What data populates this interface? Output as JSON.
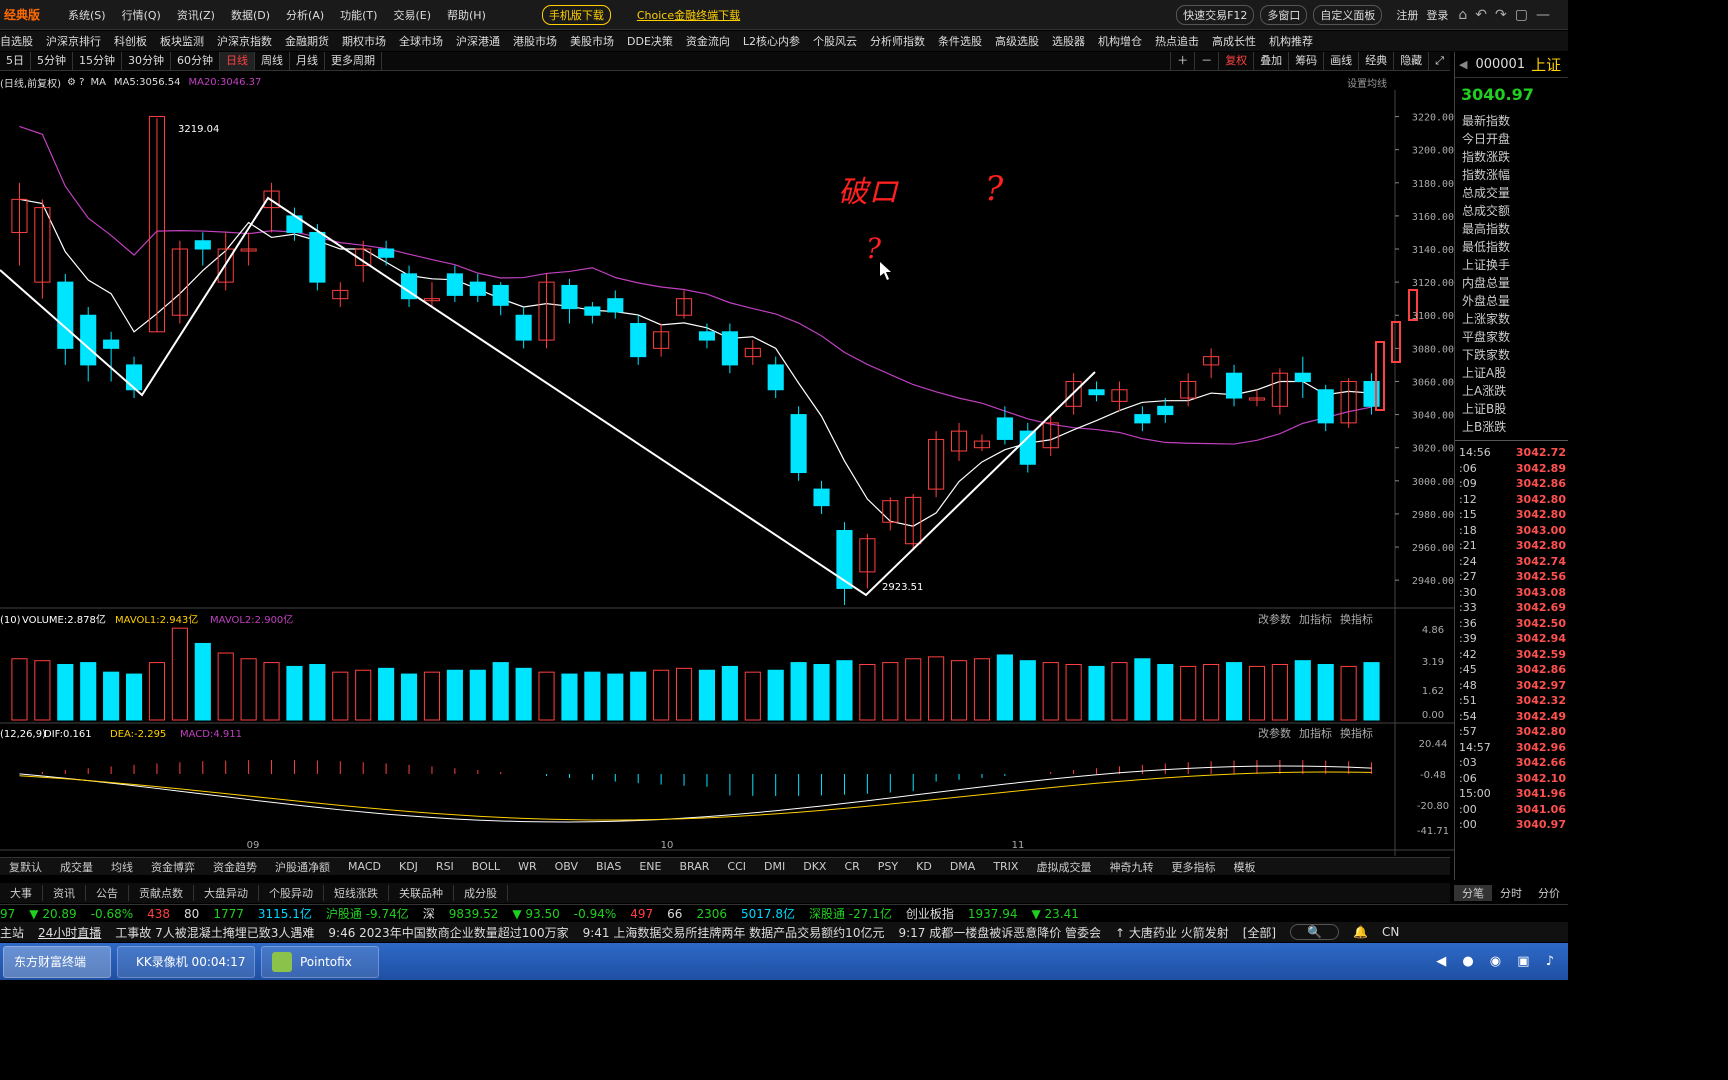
{
  "app": {
    "logo": "经典版",
    "menus": [
      "系统(S)",
      "行情(Q)",
      "资讯(Z)",
      "数据(D)",
      "分析(A)",
      "功能(T)",
      "交易(E)",
      "帮助(H)"
    ],
    "promo1": "手机版下载",
    "promo2": "Choice金融终端下载",
    "right_pills": [
      "快速交易F12",
      "多窗口",
      "自定义面板"
    ],
    "login": "注册",
    "logout": "登录"
  },
  "nav": [
    "自选股",
    "沪深京排行",
    "科创板",
    "板块监测",
    "沪深京指数",
    "金融期货",
    "期权市场",
    "全球市场",
    "沪深港通",
    "港股市场",
    "美股市场",
    "DDE决策",
    "资金流向",
    "L2核心内参",
    "个股风云",
    "分析师指数",
    "条件选股",
    "高级选股",
    "选股器",
    "机构增仓",
    "热点追击",
    "高成长性",
    "机构推荐"
  ],
  "periods": [
    "5日",
    "5分钟",
    "15分钟",
    "30分钟",
    "60分钟",
    "日线",
    "周线",
    "月线",
    "更多周期"
  ],
  "period_active": "日线",
  "tools": [
    "复权",
    "叠加",
    "筹码",
    "画线",
    "经典",
    "隐藏"
  ],
  "info": {
    "label": "(日线,前复权)",
    "ma": "MA",
    "ma5": "MA5:3056.54",
    "ma20": "MA20:3046.37",
    "settings": "设置均线"
  },
  "annotations": {
    "high": "3219.04",
    "low": "2923.51"
  },
  "handwriting": {
    "line1": "破ロ",
    "line2": "?",
    "line3": "?"
  },
  "y_axis": [
    "3220.00",
    "3200.00",
    "3180.00",
    "3160.00",
    "3140.00",
    "3120.00",
    "3100.00",
    "3080.00",
    "3060.00",
    "3040.00",
    "3020.00",
    "3000.00",
    "2980.00",
    "2960.00",
    "2940.00"
  ],
  "x_labels": [
    "09",
    "10",
    "11"
  ],
  "volume": {
    "label": "(10)",
    "vol": "VOLUME:2.878亿",
    "mavol1": "MAVOL1:2.943亿",
    "mavol2": "MAVOL2:2.900亿",
    "axis": [
      "4.86",
      "3.19",
      "1.62",
      "0.00"
    ],
    "btns": [
      "改参数",
      "加指标",
      "换指标"
    ]
  },
  "macd": {
    "label": "(12,26,9)",
    "dif": "DIF:0.161",
    "dea": "DEA:-2.295",
    "macd": "MACD:4.911",
    "axis": [
      "20.44",
      "-0.48",
      "-20.80",
      "-41.71"
    ],
    "btns": [
      "改参数",
      "加指标",
      "换指标"
    ]
  },
  "indicators": [
    "复默认",
    "成交量",
    "均线",
    "资金博弈",
    "资金趋势",
    "沪股通净额",
    "MACD",
    "KDJ",
    "RSI",
    "BOLL",
    "WR",
    "OBV",
    "BIAS",
    "ENE",
    "BRAR",
    "CCI",
    "DMI",
    "DKX",
    "CR",
    "PSY",
    "KD",
    "DMA",
    "TRIX",
    "虚拟成交量",
    "神奇九转",
    "更多指标",
    "模板"
  ],
  "tabs2": [
    "大事",
    "资讯",
    "公告",
    "贡献点数",
    "大盘异动",
    "个股异动",
    "短线涨跌",
    "关联品种",
    "成分股"
  ],
  "right_panel": {
    "code": "000001",
    "name": "上证",
    "price": "3040.97",
    "labels": [
      "最新指数",
      "今日开盘",
      "指数涨跌",
      "指数涨幅",
      "总成交量",
      "总成交额",
      "最高指数",
      "最低指数",
      "上证换手",
      "内盘总量",
      "外盘总量",
      "上涨家数",
      "平盘家数",
      "下跌家数",
      "上证A股",
      "上A涨跌",
      "上证B股",
      "上B涨跌"
    ],
    "ticks": [
      [
        "14:56",
        "3042.72"
      ],
      [
        ":06",
        "3042.89"
      ],
      [
        ":09",
        "3042.86"
      ],
      [
        ":12",
        "3042.80"
      ],
      [
        ":15",
        "3042.80"
      ],
      [
        ":18",
        "3043.00"
      ],
      [
        ":21",
        "3042.80"
      ],
      [
        ":24",
        "3042.74"
      ],
      [
        ":27",
        "3042.56"
      ],
      [
        ":30",
        "3043.08"
      ],
      [
        ":33",
        "3042.69"
      ],
      [
        ":36",
        "3042.50"
      ],
      [
        ":39",
        "3042.94"
      ],
      [
        ":42",
        "3042.59"
      ],
      [
        ":45",
        "3042.86"
      ],
      [
        ":48",
        "3042.97"
      ],
      [
        ":51",
        "3042.32"
      ],
      [
        ":54",
        "3042.49"
      ],
      [
        ":57",
        "3042.80"
      ],
      [
        "14:57",
        "3042.96"
      ],
      [
        ":03",
        "3042.66"
      ],
      [
        ":06",
        "3042.10"
      ],
      [
        "15:00",
        "3041.96"
      ],
      [
        ":00",
        "3041.06"
      ],
      [
        ":00",
        "3040.97"
      ]
    ],
    "tabs": [
      "分笔",
      "分时",
      "分价"
    ]
  },
  "stat": {
    "a": "97",
    "b": "▼ 20.89",
    "c": "-0.68%",
    "d": "438",
    "e": "80",
    "f": "1777",
    "g": "3115.1亿",
    "h": "沪股通 -9.74亿",
    "i": "深",
    "j": "9839.52",
    "k": "▼ 93.50",
    "l": "-0.94%",
    "m": "497",
    "n": "66",
    "o": "2306",
    "p": "5017.8亿",
    "q": "深股通 -27.1亿",
    "r": "创业板指",
    "s": "1937.94",
    "t": "▼ 23.41"
  },
  "news": {
    "tag": "主站",
    "live": "24小时直播",
    "items": [
      "工事故 7人被混凝土掩埋已致3人遇难",
      "9:46 2023年中国数商企业数量超过100万家",
      "9:41 上海数据交易所挂牌两年 数据产品交易额约10亿元",
      "9:17 成都一楼盘被诉恶意降价 管委会"
    ],
    "hot": "↑ 大唐药业 火箭发射",
    "all": "[全部]",
    "lang": "CN"
  },
  "taskbar": [
    "东方财富终端",
    "KK录像机 00:04:17",
    "Pointofix"
  ],
  "colors": {
    "up": "#ff4040",
    "down": "#00e5ff",
    "ma20": "#c040c0",
    "ma5": "#ffffff"
  },
  "chart_data": {
    "type": "candlestick",
    "ylim": [
      2923.51,
      3219.04
    ],
    "candles": [
      [
        3150,
        3170,
        3130,
        3180
      ],
      [
        3120,
        3165,
        3110,
        3170
      ],
      [
        3120,
        3080,
        3070,
        3125
      ],
      [
        3100,
        3070,
        3060,
        3105
      ],
      [
        3085,
        3080,
        3060,
        3090
      ],
      [
        3070,
        3055,
        3050,
        3075
      ],
      [
        3090,
        3220,
        3090,
        3219
      ],
      [
        3100,
        3140,
        3095,
        3145
      ],
      [
        3145,
        3140,
        3130,
        3150
      ],
      [
        3120,
        3140,
        3115,
        3150
      ],
      [
        3140,
        3140,
        3130,
        3150
      ],
      [
        3165,
        3175,
        3150,
        3180
      ],
      [
        3160,
        3150,
        3145,
        3165
      ],
      [
        3150,
        3120,
        3115,
        3155
      ],
      [
        3110,
        3115,
        3105,
        3120
      ],
      [
        3130,
        3140,
        3120,
        3145
      ],
      [
        3140,
        3135,
        3130,
        3145
      ],
      [
        3125,
        3110,
        3105,
        3130
      ],
      [
        3110,
        3110,
        3105,
        3120
      ],
      [
        3125,
        3112,
        3108,
        3130
      ],
      [
        3120,
        3112,
        3108,
        3125
      ],
      [
        3118,
        3106,
        3100,
        3120
      ],
      [
        3100,
        3085,
        3080,
        3105
      ],
      [
        3085,
        3120,
        3080,
        3125
      ],
      [
        3118,
        3104,
        3095,
        3122
      ],
      [
        3105,
        3100,
        3095,
        3108
      ],
      [
        3110,
        3102,
        3098,
        3115
      ],
      [
        3095,
        3075,
        3070,
        3100
      ],
      [
        3080,
        3090,
        3075,
        3095
      ],
      [
        3100,
        3110,
        3098,
        3115
      ],
      [
        3090,
        3085,
        3080,
        3095
      ],
      [
        3090,
        3070,
        3065,
        3095
      ],
      [
        3075,
        3080,
        3070,
        3085
      ],
      [
        3070,
        3055,
        3050,
        3075
      ],
      [
        3040,
        3005,
        3000,
        3045
      ],
      [
        2995,
        2985,
        2980,
        3000
      ],
      [
        2970,
        2935,
        2925,
        2975
      ],
      [
        2945,
        2965,
        2935,
        2968
      ],
      [
        2975,
        2988,
        2970,
        2990
      ],
      [
        2962,
        2990,
        2958,
        2992
      ],
      [
        2995,
        3025,
        2990,
        3030
      ],
      [
        3018,
        3030,
        3012,
        3035
      ],
      [
        3020,
        3024,
        3018,
        3028
      ],
      [
        3038,
        3025,
        3022,
        3045
      ],
      [
        3030,
        3010,
        3005,
        3035
      ],
      [
        3020,
        3035,
        3015,
        3040
      ],
      [
        3045,
        3060,
        3040,
        3065
      ],
      [
        3055,
        3052,
        3048,
        3060
      ],
      [
        3048,
        3055,
        3042,
        3060
      ],
      [
        3040,
        3035,
        3030,
        3045
      ],
      [
        3045,
        3040,
        3035,
        3050
      ],
      [
        3050,
        3060,
        3045,
        3065
      ],
      [
        3070,
        3075,
        3062,
        3080
      ],
      [
        3065,
        3050,
        3045,
        3070
      ],
      [
        3050,
        3050,
        3045,
        3055
      ],
      [
        3045,
        3065,
        3040,
        3068
      ],
      [
        3065,
        3060,
        3050,
        3075
      ],
      [
        3055,
        3035,
        3030,
        3058
      ],
      [
        3035,
        3060,
        3032,
        3062
      ],
      [
        3060,
        3045,
        3040,
        3065
      ]
    ],
    "volumes": [
      3.2,
      3.1,
      2.9,
      3.0,
      2.5,
      2.4,
      3.0,
      4.8,
      4.0,
      3.5,
      3.2,
      3.0,
      2.8,
      2.9,
      2.5,
      2.6,
      2.7,
      2.4,
      2.5,
      2.6,
      2.6,
      3.0,
      2.7,
      2.5,
      2.4,
      2.5,
      2.4,
      2.5,
      2.6,
      2.7,
      2.6,
      2.8,
      2.5,
      2.6,
      3.0,
      2.9,
      3.1,
      2.9,
      3.0,
      3.2,
      3.3,
      3.1,
      3.2,
      3.4,
      3.1,
      3.0,
      2.9,
      2.8,
      3.0,
      3.2,
      2.9,
      2.8,
      2.9,
      3.0,
      2.8,
      2.9,
      3.1,
      2.9,
      2.8,
      3.0,
      3.2
    ]
  }
}
